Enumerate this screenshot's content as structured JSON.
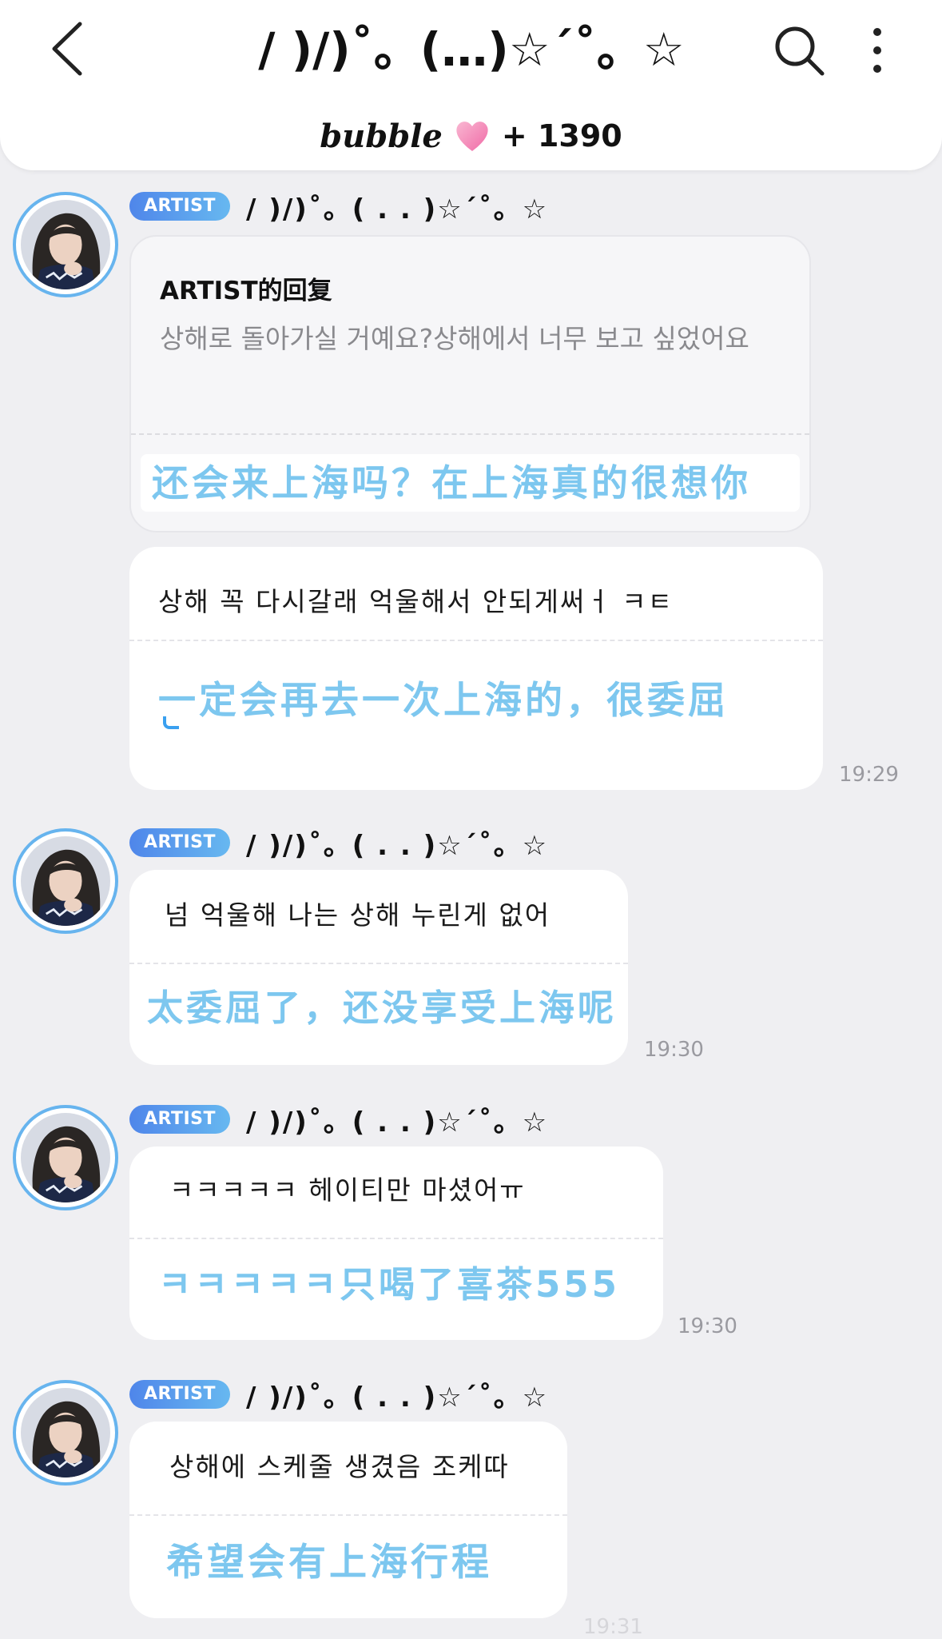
{
  "header": {
    "title": "/ )/)˚。(…)☆´˚。☆",
    "brand": "bubble",
    "count": "+ 1390"
  },
  "reply": {
    "title": "ARTIST的回复",
    "quote": "상해로 돌아가실 거예요?상해에서 너무 보고 싶었어요",
    "translation": "还会来上海吗？在上海真的很想你"
  },
  "messages": [
    {
      "badge": "ARTIST",
      "name": "/ )/)˚。( . . )☆´˚。☆",
      "korean": "상해 꼭 다시갈래 억울해서 안되게써ㅓ ㅋㅌ",
      "chinese": "一定会再去一次上海的，很委屈",
      "time": "19:29"
    },
    {
      "badge": "ARTIST",
      "name": "/ )/)˚。( . . )☆´˚。☆",
      "korean": "넘 억울해 나는 상해 누린게 없어",
      "chinese": "太委屈了，还没享受上海呢",
      "time": "19:30"
    },
    {
      "badge": "ARTIST",
      "name": "/ )/)˚。( . . )☆´˚。☆",
      "korean": "ㅋㅋㅋㅋㅋ 헤이티만 마셨어ㅠ",
      "chinese": "ㅋㅋㅋㅋㅋ只喝了喜茶555",
      "time": "19:30"
    },
    {
      "badge": "ARTIST",
      "name": "/ )/)˚。( . . )☆´˚。☆",
      "korean": "상해에 스케줄 생겼음 조케따",
      "chinese": "希望会有上海行程",
      "time": "19:31"
    }
  ],
  "colors": {
    "background": "#efeff2",
    "badge_start": "#4f86ea",
    "badge_end": "#67b8f0",
    "translation": "#7dc7ef",
    "avatar_ring": "#67b4ee",
    "heart": "#f27fb0"
  }
}
